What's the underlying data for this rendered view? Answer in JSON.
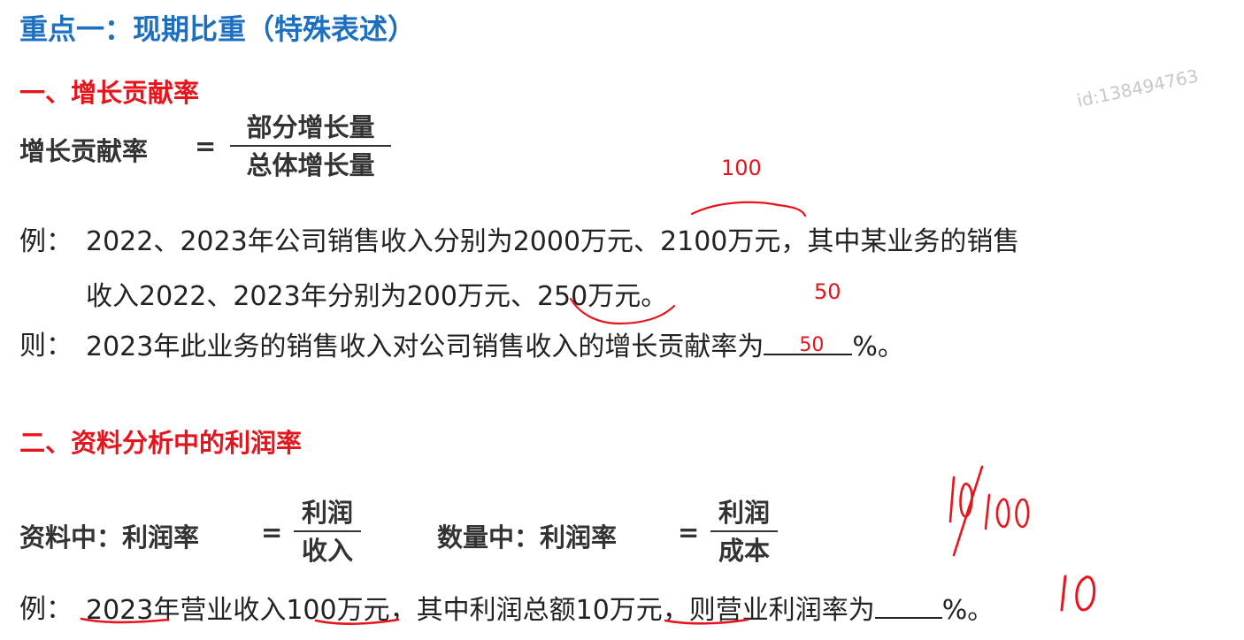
{
  "title": "重点一：现期比重（特殊表述）",
  "watermark": "id:138494763",
  "section1": {
    "heading": "一、增长贡献率",
    "formula_label": "增长贡献率",
    "equals": "=",
    "numerator": "部分增长量",
    "denominator": "总体增长量",
    "example_label": "例：",
    "example_line1": "2022、2023年公司销售收入分别为2000万元、2100万元，其中某业务的销售",
    "example_line2": "收入2022、2023年分别为200万元、250万元。",
    "question_label": "则：",
    "question_text": "2023年此业务的销售收入对公司销售收入的增长贡献率为",
    "question_suffix": "%。",
    "annot_top": "100",
    "annot_mid": "50",
    "annot_answer": "50"
  },
  "section2": {
    "heading": "二、资料分析中的利润率",
    "formula1_label": "资料中：利润率",
    "formula1_num": "利润",
    "formula1_den": "收入",
    "formula2_label": "数量中：利润率",
    "formula2_num": "利润",
    "formula2_den": "成本",
    "equals": "=",
    "example_label": "例：",
    "example_text_before": "2023年营业收入100万元，其中利润总额10万元，则营业利润率为",
    "example_suffix": "%。",
    "hand_ratio": "10/100",
    "hand_answer": "10"
  },
  "colors": {
    "title": "#1e6fc0",
    "heading": "#e8141c",
    "annotation": "#e8141c",
    "text": "#222222"
  }
}
